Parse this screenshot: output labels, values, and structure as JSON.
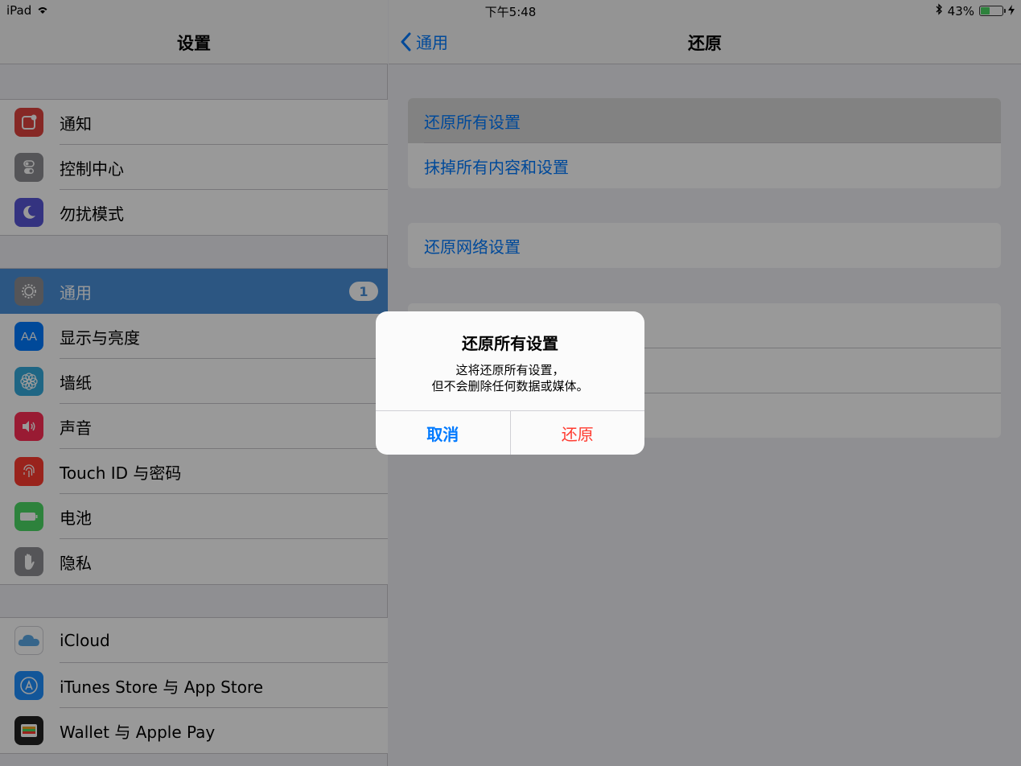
{
  "status_bar": {
    "device": "iPad",
    "time": "下午5:48",
    "battery_percent": "43%",
    "battery_level": 0.43
  },
  "master": {
    "title": "设置",
    "groups": [
      [
        {
          "label": "通知",
          "icon": "notifications-icon",
          "color": "#e0443e"
        },
        {
          "label": "控制中心",
          "icon": "control-center-icon",
          "color": "#8e8e93"
        },
        {
          "label": "勿扰模式",
          "icon": "moon-icon",
          "color": "#5856d6"
        }
      ],
      [
        {
          "label": "通用",
          "icon": "gear-icon",
          "color": "#8e8e93",
          "badge": "1",
          "selected": true
        },
        {
          "label": "显示与亮度",
          "icon": "display-icon",
          "color": "#007aff"
        },
        {
          "label": "墙纸",
          "icon": "wallpaper-icon",
          "color": "#34aadc"
        },
        {
          "label": "声音",
          "icon": "speaker-icon",
          "color": "#ff2d55"
        },
        {
          "label": "Touch ID 与密码",
          "icon": "fingerprint-icon",
          "color": "#ff3b30"
        },
        {
          "label": "电池",
          "icon": "battery-icon",
          "color": "#4cd964"
        },
        {
          "label": "隐私",
          "icon": "hand-icon",
          "color": "#8e8e93"
        }
      ],
      [
        {
          "label": "iCloud",
          "icon": "cloud-icon",
          "color": "#ffffff"
        },
        {
          "label": "iTunes Store 与 App Store",
          "icon": "app-store-icon",
          "color": "#1e90ff"
        },
        {
          "label": "Wallet 与 Apple Pay",
          "icon": "wallet-icon",
          "color": "#222222"
        }
      ]
    ]
  },
  "detail": {
    "back_label": "通用",
    "title": "还原",
    "group1": [
      "还原所有设置",
      "抹掉所有内容和设置"
    ],
    "group2": [
      "还原网络设置"
    ]
  },
  "alert": {
    "title": "还原所有设置",
    "message_line1": "这将还原所有设置，",
    "message_line2": "但不会删除任何数据或媒体。",
    "cancel_label": "取消",
    "confirm_label": "还原"
  }
}
